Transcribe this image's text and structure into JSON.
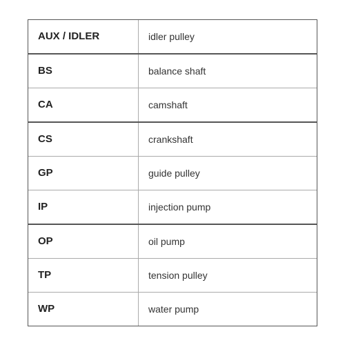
{
  "table": {
    "rows": [
      {
        "abbr": "AUX / IDLER",
        "desc": "idler pulley",
        "thick": true
      },
      {
        "abbr": "BS",
        "desc": "balance shaft",
        "thick": false
      },
      {
        "abbr": "CA",
        "desc": "camshaft",
        "thick": true
      },
      {
        "abbr": "CS",
        "desc": "crankshaft",
        "thick": false
      },
      {
        "abbr": "GP",
        "desc": "guide pulley",
        "thick": false
      },
      {
        "abbr": "IP",
        "desc": "injection pump",
        "thick": true
      },
      {
        "abbr": "OP",
        "desc": "oil pump",
        "thick": false
      },
      {
        "abbr": "TP",
        "desc": "tension pulley",
        "thick": false
      },
      {
        "abbr": "WP",
        "desc": "water pump",
        "thick": false
      }
    ]
  }
}
